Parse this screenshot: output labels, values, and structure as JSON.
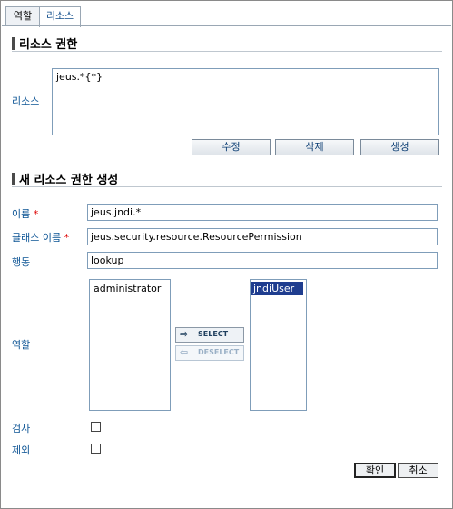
{
  "tabs": [
    {
      "label": "역할",
      "active": false
    },
    {
      "label": "리소스",
      "active": true
    }
  ],
  "resource_permission": {
    "title": "리소스 권한",
    "resource_label": "리소스",
    "resource_value": "jeus.*{*}",
    "buttons": {
      "edit": "수정",
      "delete": "삭제",
      "create": "생성"
    }
  },
  "new_permission": {
    "title": "새 리소스 권한 생성",
    "name_label": "이름",
    "name_value": "jeus.jndi.*",
    "class_label": "클래스 이름",
    "class_value": "jeus.security.resource.ResourcePermission",
    "action_label": "행동",
    "action_value": "lookup",
    "required_mark": "*",
    "role_label": "역할",
    "available_roles": [
      "administrator"
    ],
    "selected_roles": [
      "jndiUser"
    ],
    "select_label": "SELECT",
    "deselect_label": "DESELECT",
    "audit_label": "검사",
    "exclude_label": "제외"
  },
  "footer": {
    "ok": "확인",
    "cancel": "취소"
  },
  "colors": {
    "label": "#0b5394",
    "required": "#dd0000",
    "selection": "#1f3d8f"
  }
}
